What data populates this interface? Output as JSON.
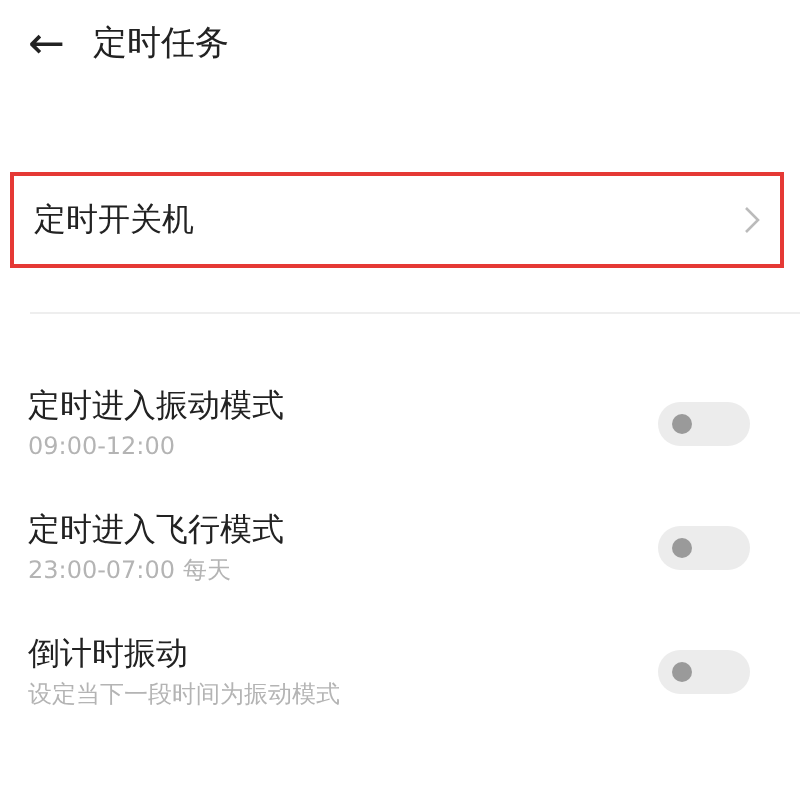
{
  "header": {
    "back_icon": "←",
    "title": "定时任务"
  },
  "timer_power": {
    "label": "定时开关机",
    "highlighted": true
  },
  "tasks": [
    {
      "title": "定时进入振动模式",
      "subtitle": "09:00-12:00",
      "on": false
    },
    {
      "title": "定时进入飞行模式",
      "subtitle": "23:00-07:00 每天",
      "on": false
    },
    {
      "title": "倒计时振动",
      "subtitle": "设定当下一段时间为振动模式",
      "on": false
    }
  ]
}
